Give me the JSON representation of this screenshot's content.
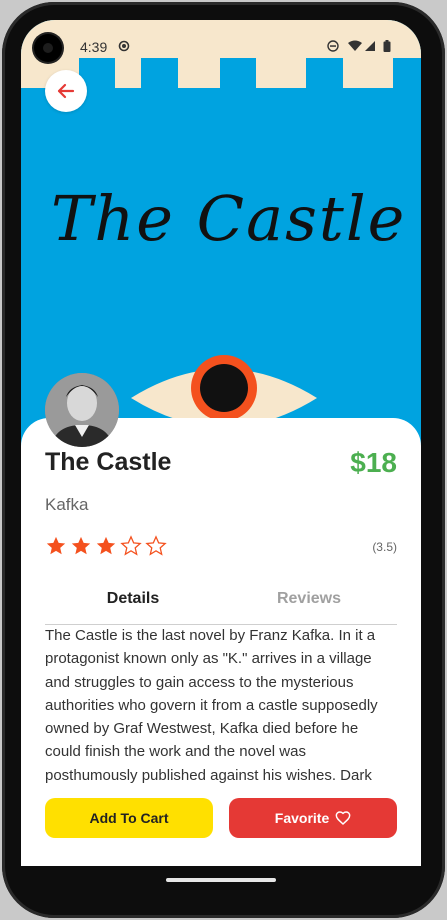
{
  "status": {
    "time": "4:39",
    "icons": [
      "circle-icon",
      "do-not-disturb-icon",
      "wifi-icon",
      "signal-icon",
      "battery-icon"
    ]
  },
  "cover": {
    "title": "The Castle",
    "background": "#00a3e0",
    "battlement_color": "#f7e7cc"
  },
  "book": {
    "title": "The Castle",
    "price": "$18",
    "author": "Kafka",
    "rating_text": "(3.5)",
    "rating": 3.5,
    "stars_filled": 3,
    "stars_total": 5
  },
  "tabs": {
    "details": "Details",
    "reviews": "Reviews"
  },
  "description": "The Castle is the last novel by Franz Kafka. In it a protagonist known only as \"K.\" arrives in a village and struggles to gain access to the mysterious authorities who govern it from a castle supposedly owned by Graf Westwest, Kafka died before he could finish the work and the novel was posthumously published against his wishes. Dark",
  "actions": {
    "add_to_cart": "Add To Cart",
    "favorite": "Favorite"
  },
  "colors": {
    "price": "#4caf50",
    "star": "#f4511e",
    "cart_button": "#ffe000",
    "favorite_button": "#e53935"
  }
}
